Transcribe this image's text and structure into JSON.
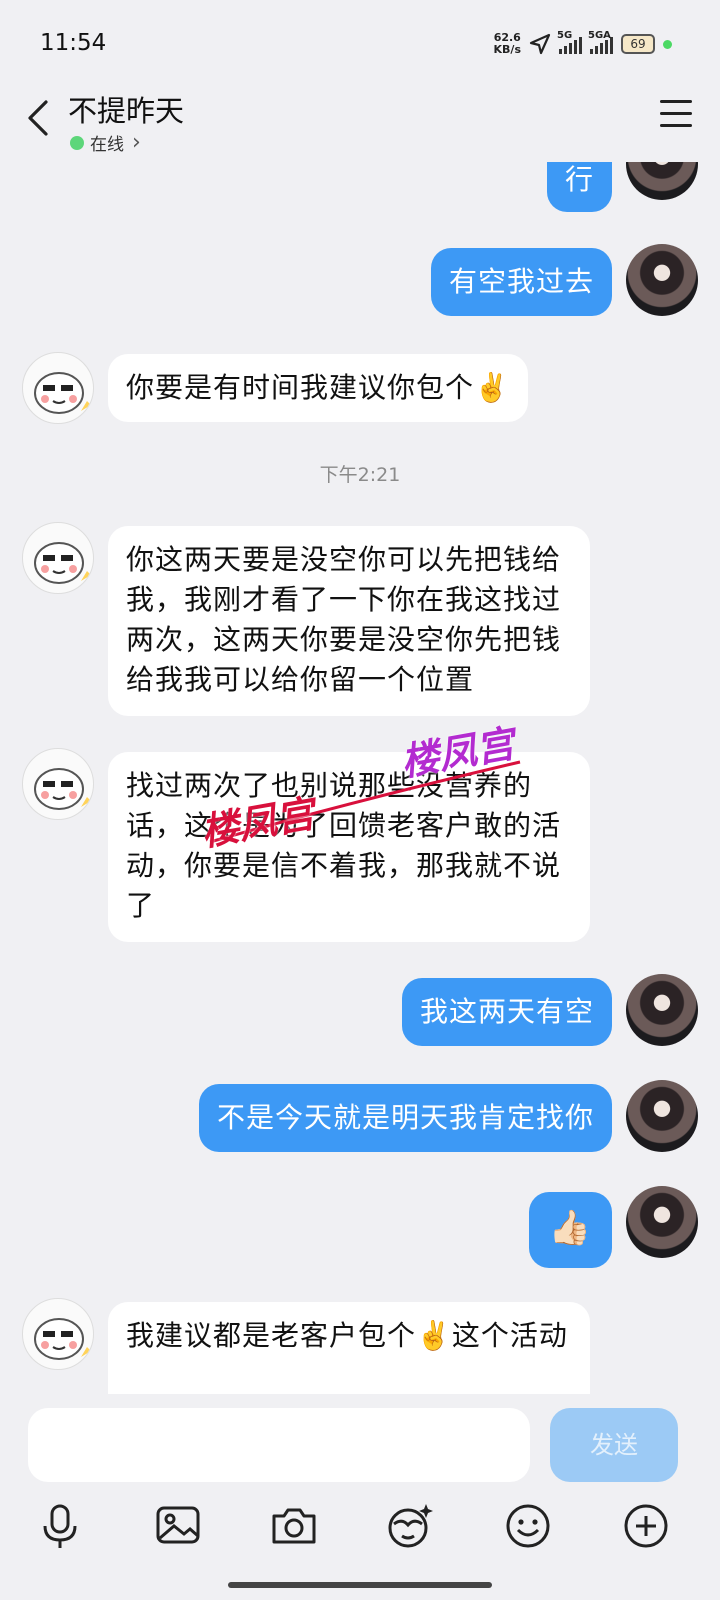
{
  "status_bar": {
    "time": "11:54",
    "net_speed_value": "62.6",
    "net_speed_unit": "KB/s",
    "sig1_label": "5G",
    "sig2_label": "5GA",
    "battery": "69"
  },
  "header": {
    "contact_name": "不提昨天",
    "status": "在线",
    "status_chevron": "›"
  },
  "chat": {
    "messages": [
      {
        "dir": "out",
        "text": "行"
      },
      {
        "dir": "out",
        "text": "有空我过去"
      },
      {
        "dir": "in",
        "text": "你要是有时间我建议你包个✌️"
      },
      {
        "dir": "in",
        "text": "你这两天要是没空你可以先把钱给我，我刚才看了一下你在我这找过两次，这两天你要是没空你先把钱给我我可以给你留一个位置"
      },
      {
        "dir": "in",
        "text": "找过两次了也别说那些没营养的话，这个是为了回馈老客户敢的活动，你要是信不着我，那我就不说了"
      },
      {
        "dir": "out",
        "text": "我这两天有空"
      },
      {
        "dir": "out",
        "text": "不是今天就是明天我肯定找你"
      },
      {
        "dir": "out",
        "text": "👍🏻"
      },
      {
        "dir": "in",
        "text": "我建议都是老客户包个✌️这个活动"
      }
    ],
    "time_divider": "下午2:21",
    "watermark_1": "楼凤宫",
    "watermark_2": "楼凤宫"
  },
  "input": {
    "placeholder": "",
    "send_label": "发送"
  },
  "icons": [
    "chevron-left-icon",
    "menu-icon",
    "microphone-icon",
    "image-icon",
    "camera-icon",
    "sticker-icon",
    "emoji-icon",
    "plus-icon"
  ],
  "colors": {
    "outgoing_bubble": "#3d99f5",
    "incoming_bubble": "#ffffff",
    "background": "#f0f0f3",
    "online": "#5dd67a"
  }
}
